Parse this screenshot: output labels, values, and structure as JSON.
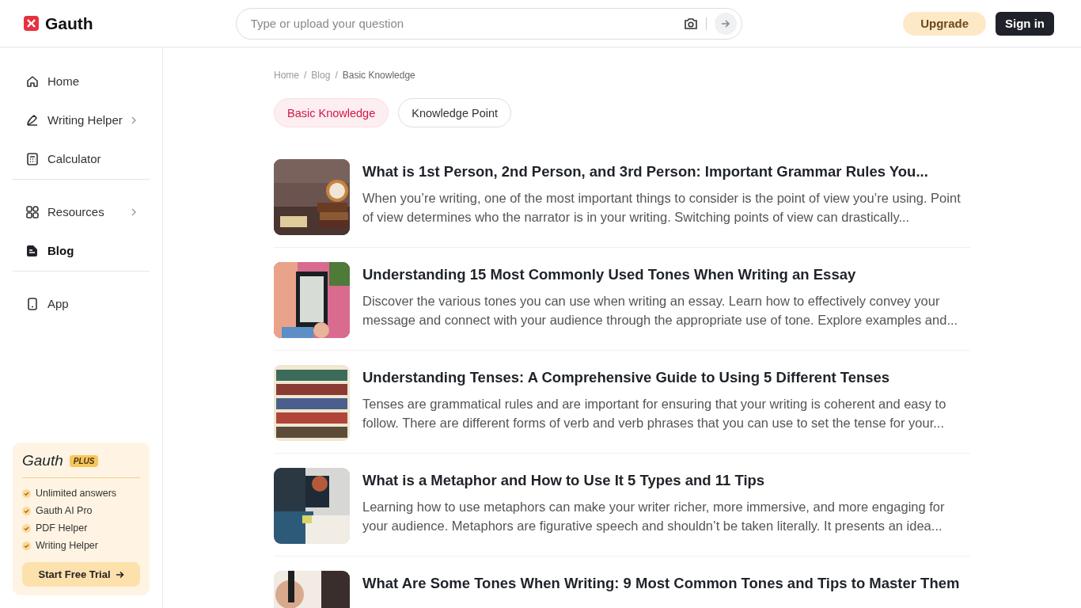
{
  "header": {
    "logo": "Gauth",
    "search": {
      "placeholder": "Type or upload your question"
    },
    "upgrade": "Upgrade",
    "sign_in": "Sign in"
  },
  "sidebar": {
    "groups": [
      {
        "items": [
          {
            "label": "Home",
            "has_submenu": false,
            "selected": false
          },
          {
            "label": "Writing Helper",
            "has_submenu": true,
            "selected": false
          },
          {
            "label": "Calculator",
            "has_submenu": false,
            "selected": false
          }
        ]
      },
      {
        "items": [
          {
            "label": "Resources",
            "has_submenu": true,
            "selected": false
          },
          {
            "label": "Blog",
            "has_submenu": false,
            "selected": true
          }
        ]
      },
      {
        "items": [
          {
            "label": "App",
            "has_submenu": false,
            "selected": false
          }
        ]
      }
    ],
    "plus": {
      "brand": "Gauth",
      "badge": "PLUS",
      "features": [
        "Unlimited answers",
        "Gauth AI Pro",
        "PDF Helper",
        "Writing Helper"
      ],
      "button": "Start Free Trial"
    }
  },
  "breadcrumb": [
    {
      "kind": "link",
      "text": "Home"
    },
    {
      "kind": "separator",
      "text": "/"
    },
    {
      "kind": "link",
      "text": "Blog"
    },
    {
      "kind": "separator",
      "text": "/"
    },
    {
      "kind": "current",
      "text": "Basic Knowledge"
    }
  ],
  "tabs": [
    {
      "label": "Basic Knowledge",
      "selected": true
    },
    {
      "label": "Knowledge Point",
      "selected": false
    }
  ],
  "articles": [
    {
      "title": "What is 1st Person, 2nd Person, and 3rd Person: Important Grammar Rules You...",
      "excerpt": "When you’re writing, one of the most important things to consider is the point of view you’re using. Point of view determines who the narrator is in your writing. Switching points of view can drastically..."
    },
    {
      "title": "Understanding 15 Most Commonly Used Tones When Writing an Essay",
      "excerpt": "Discover the various tones you can use when writing an essay. Learn how to effectively convey your message and connect with your audience through the appropriate use of tone. Explore examples and..."
    },
    {
      "title": "Understanding Tenses: A Comprehensive Guide to Using 5 Different Tenses",
      "excerpt": "Tenses are grammatical rules and are important for ensuring that your writing is coherent and easy to follow. There are different forms of verb and verb phrases that you can use to set the tense for your..."
    },
    {
      "title": "What is a Metaphor and How to Use It  5 Types and 11 Tips",
      "excerpt": "Learning how to use metaphors can make your writer richer, more immersive, and more engaging for your audience. Metaphors are figurative speech and shouldn’t be taken literally. It presents an idea..."
    },
    {
      "title": "What Are Some Tones When Writing: 9 Most Common Tones and Tips to Master Them"
    }
  ]
}
